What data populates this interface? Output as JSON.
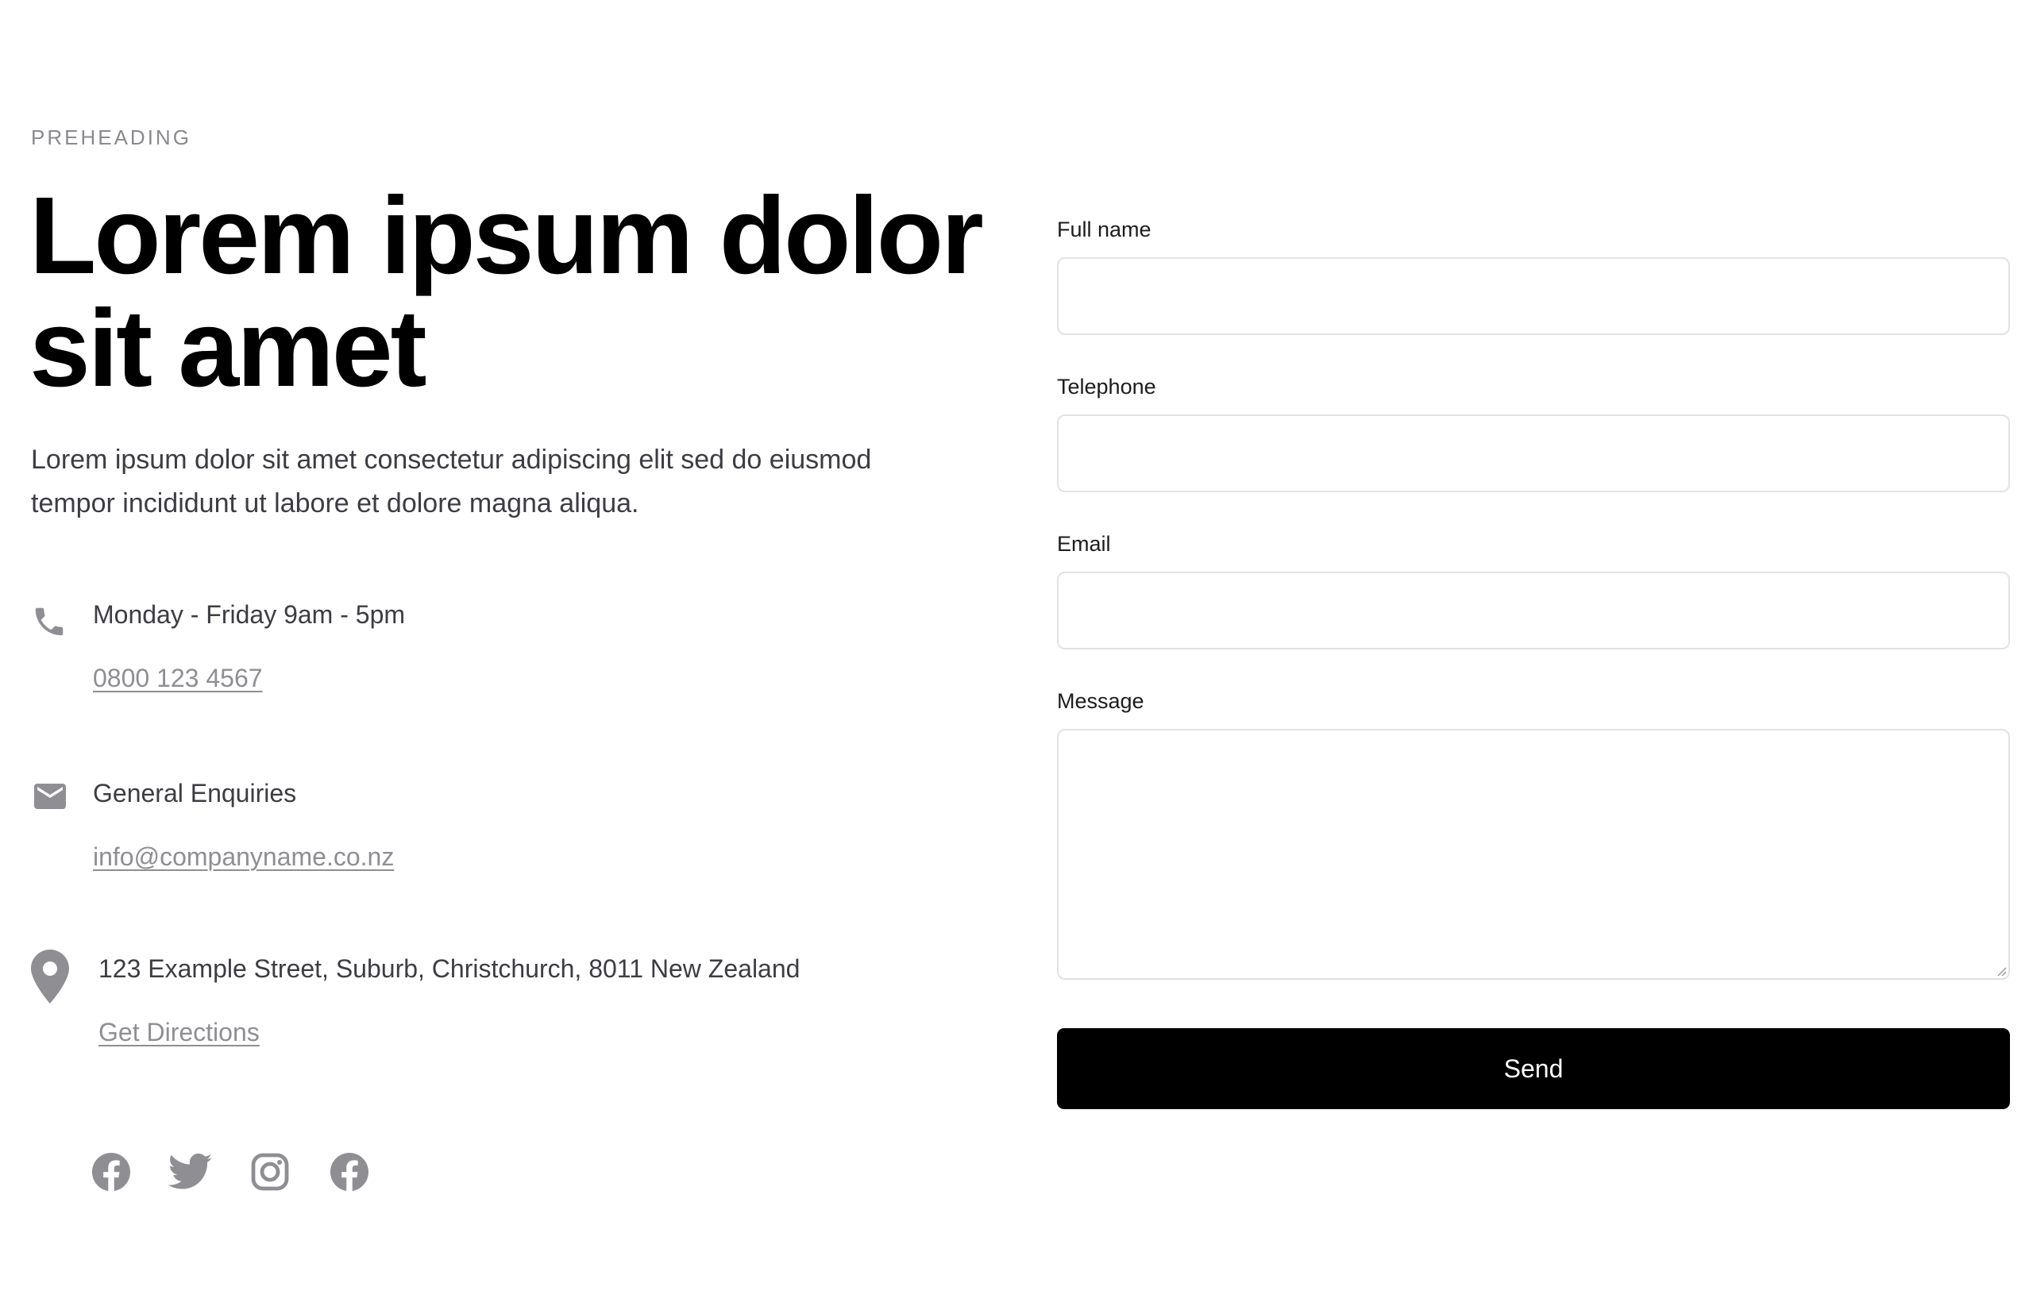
{
  "hero": {
    "preheading": "PREHEADING",
    "title": "Lorem ipsum dolor sit amet",
    "description": "Lorem ipsum dolor sit amet consectetur adipiscing elit sed do eiusmod tempor incididunt ut labore et dolore magna aliqua."
  },
  "contact": {
    "phone": {
      "icon": "phone-icon",
      "label": "Monday - Friday 9am - 5pm",
      "link": "0800 123 4567"
    },
    "email": {
      "icon": "mail-icon",
      "label": "General Enquiries",
      "link": "info@companyname.co.nz"
    },
    "address": {
      "icon": "map-pin-icon",
      "label": "123 Example Street, Suburb, Christchurch, 8011 New Zealand",
      "link": "Get Directions"
    }
  },
  "social": [
    {
      "icon": "facebook-icon"
    },
    {
      "icon": "twitter-icon"
    },
    {
      "icon": "instagram-icon"
    },
    {
      "icon": "facebook-icon"
    }
  ],
  "form": {
    "full_name": {
      "label": "Full name",
      "value": "",
      "placeholder": ""
    },
    "telephone": {
      "label": "Telephone",
      "value": "",
      "placeholder": ""
    },
    "email": {
      "label": "Email",
      "value": "",
      "placeholder": ""
    },
    "message": {
      "label": "Message",
      "value": "",
      "placeholder": ""
    },
    "submit_label": "Send"
  },
  "colors": {
    "text_primary": "#000000",
    "text_body": "#3c3c43",
    "muted": "#8e8e93",
    "input_border": "#e2e2e6",
    "button_bg": "#000000",
    "button_text": "#ffffff"
  }
}
